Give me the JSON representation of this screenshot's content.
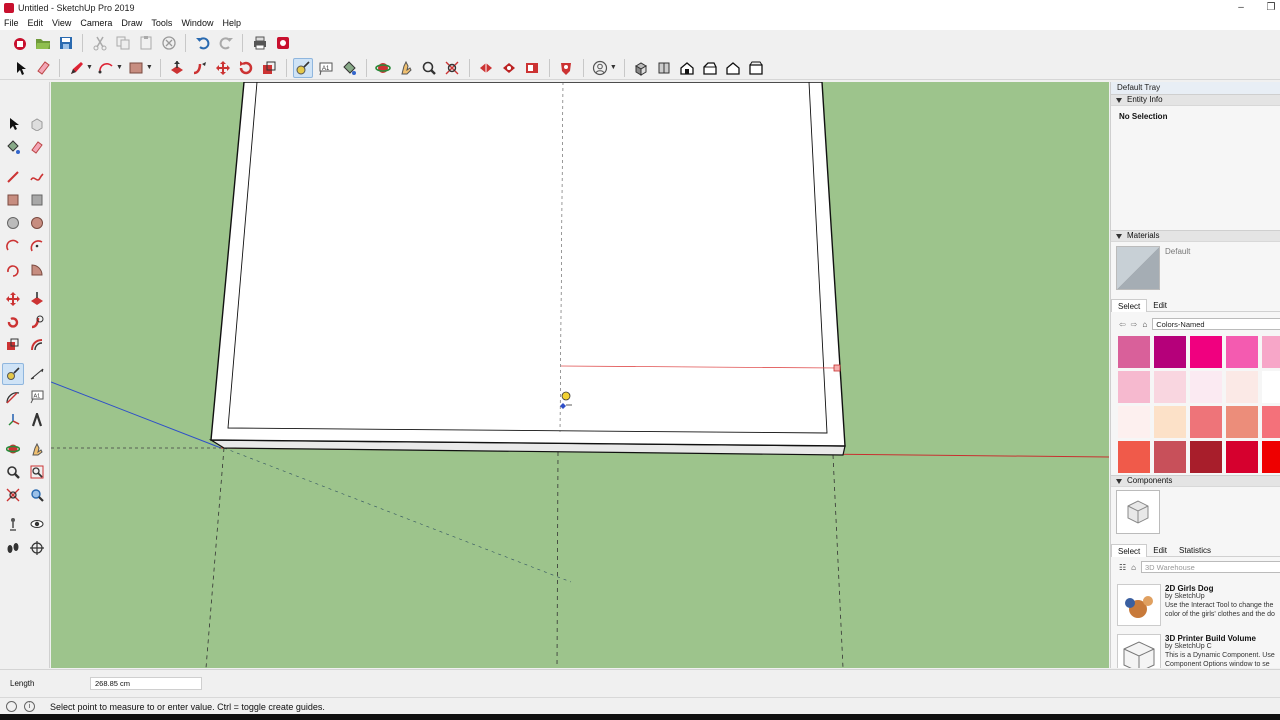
{
  "window": {
    "title": "Untitled - SketchUp Pro 2019",
    "minimize_glyph": "–",
    "restore_glyph": "❐"
  },
  "menu": [
    "File",
    "Edit",
    "View",
    "Camera",
    "Draw",
    "Tools",
    "Window",
    "Help"
  ],
  "toolbar_top": [
    "component-icon",
    "open-icon",
    "save-icon",
    "cut-icon",
    "copy-icon",
    "paste-icon",
    "erase-icon",
    "undo-icon",
    "redo-icon",
    "print-icon",
    "model-info-icon"
  ],
  "toolbar_main": [
    "select-icon",
    "eraser-icon",
    "pencil-icon",
    "arc-icon",
    "rectangle-icon",
    "push-pull-icon",
    "follow-me-icon",
    "move-icon",
    "rotate-icon",
    "scale-icon",
    "tape-measure-icon",
    "text-icon",
    "paint-bucket-icon",
    "orbit-icon",
    "pan-icon",
    "zoom-icon",
    "zoom-extents-icon",
    "warehouse-icon",
    "extension-warehouse-icon",
    "layout-icon",
    "extension-manager-icon",
    "account-icon",
    "iso-view-icon",
    "top-view-icon",
    "front-view-icon",
    "right-view-icon",
    "back-view-icon",
    "left-view-icon"
  ],
  "tray": {
    "title": "Default Tray",
    "entity_info": {
      "header": "Entity Info",
      "selection": "No Selection"
    },
    "materials": {
      "header": "Materials",
      "current": "Default",
      "tab_select": "Select",
      "tab_edit": "Edit",
      "library": "Colors-Named",
      "swatches": [
        "#d9609a",
        "#b5007a",
        "#f0007f",
        "#f45bb0",
        "#f7a6c8",
        "#f6b9cf",
        "#f9d6e0",
        "#fbeaf2",
        "#fbe9e6",
        "#ffffff",
        "#fdf0ef",
        "#fce1c8",
        "#ee7479",
        "#ec8d7a",
        "#f4717a",
        "#f05a4a",
        "#c8505a",
        "#a81e2b",
        "#d6002e",
        "#ee0000"
      ]
    },
    "components": {
      "header": "Components",
      "tab_select": "Select",
      "tab_edit": "Edit",
      "tab_statistics": "Statistics",
      "search_placeholder": "3D Warehouse",
      "items": [
        {
          "title": "2D Girls Dog",
          "by": "by SketchUp",
          "desc": "Use the Interact Tool to change the color of the girls' clothes and the do"
        },
        {
          "title": "3D Printer Build Volume",
          "by": "by SketchUp C",
          "desc": "This is a Dynamic Component. Use Component Options window to se"
        }
      ]
    }
  },
  "measurements": {
    "label": "Length",
    "value": "268.85 cm"
  },
  "status": {
    "hint": "Select point to measure to or enter value.  Ctrl = toggle create guides."
  }
}
